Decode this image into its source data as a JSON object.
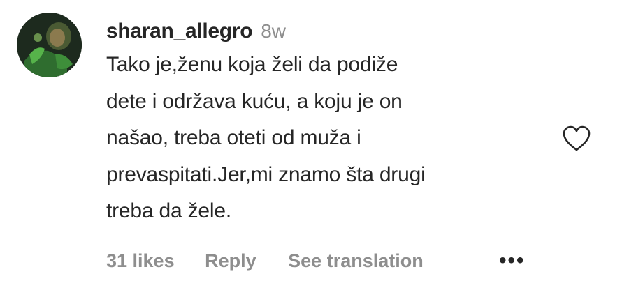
{
  "comment": {
    "username": "sharan_allegro",
    "time_ago": "8w",
    "text_lines": [
      "Tako je,ženu koja želi da podiže",
      "dete i održava kuću, a koju je on",
      "našao, treba oteti od muža i",
      "prevaspitati.Jer,mi znamo šta drugi",
      "treba da žele."
    ],
    "likes_label": "31 likes",
    "reply_label": "Reply",
    "translation_label": "See translation",
    "more_label": "•••",
    "like_icon": "heart-outline-icon",
    "avatar_icon": "avatar-photo",
    "colors": {
      "primary_text": "#262626",
      "secondary_text": "#8e8e8e",
      "background": "#ffffff"
    }
  }
}
